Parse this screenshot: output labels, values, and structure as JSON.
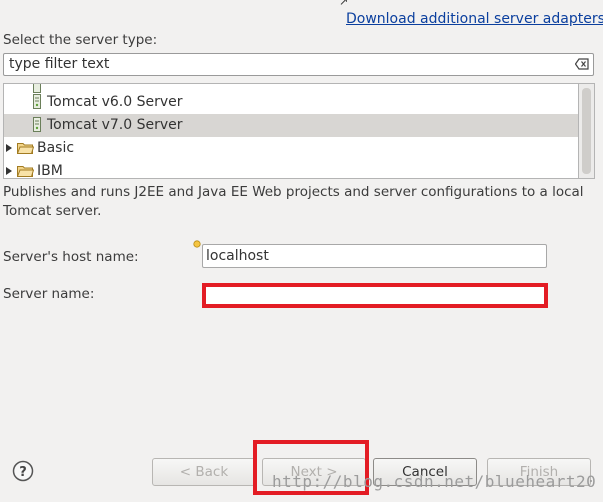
{
  "header": {
    "download_link": "Download additional server adapters"
  },
  "server_type": {
    "label": "Select the server type:",
    "filter_value": "type filter text"
  },
  "tree": {
    "items": [
      {
        "label": "Tomcat v6.0 Server",
        "icon": "server-icon",
        "selected": false
      },
      {
        "label": "Tomcat v7.0 Server",
        "icon": "server-icon",
        "selected": true
      },
      {
        "label": "Basic",
        "icon": "folder-icon",
        "expandable": true
      },
      {
        "label": "IBM",
        "icon": "folder-icon",
        "expandable": true
      }
    ]
  },
  "description": "Publishes and runs J2EE and Java EE Web projects and server configurations to a local Tomcat server.",
  "form": {
    "host_label": "Server's host name:",
    "host_value": "localhost",
    "name_label": "Server name:",
    "name_value": ""
  },
  "buttons": {
    "back": "< Back",
    "next": "Next >",
    "cancel": "Cancel",
    "finish": "Finish"
  },
  "watermark": "http://blog.csdn.net/blueheart20",
  "colors": {
    "highlight": "#e31c24",
    "link": "#0b3f9e",
    "selection": "#d8d6d3"
  }
}
